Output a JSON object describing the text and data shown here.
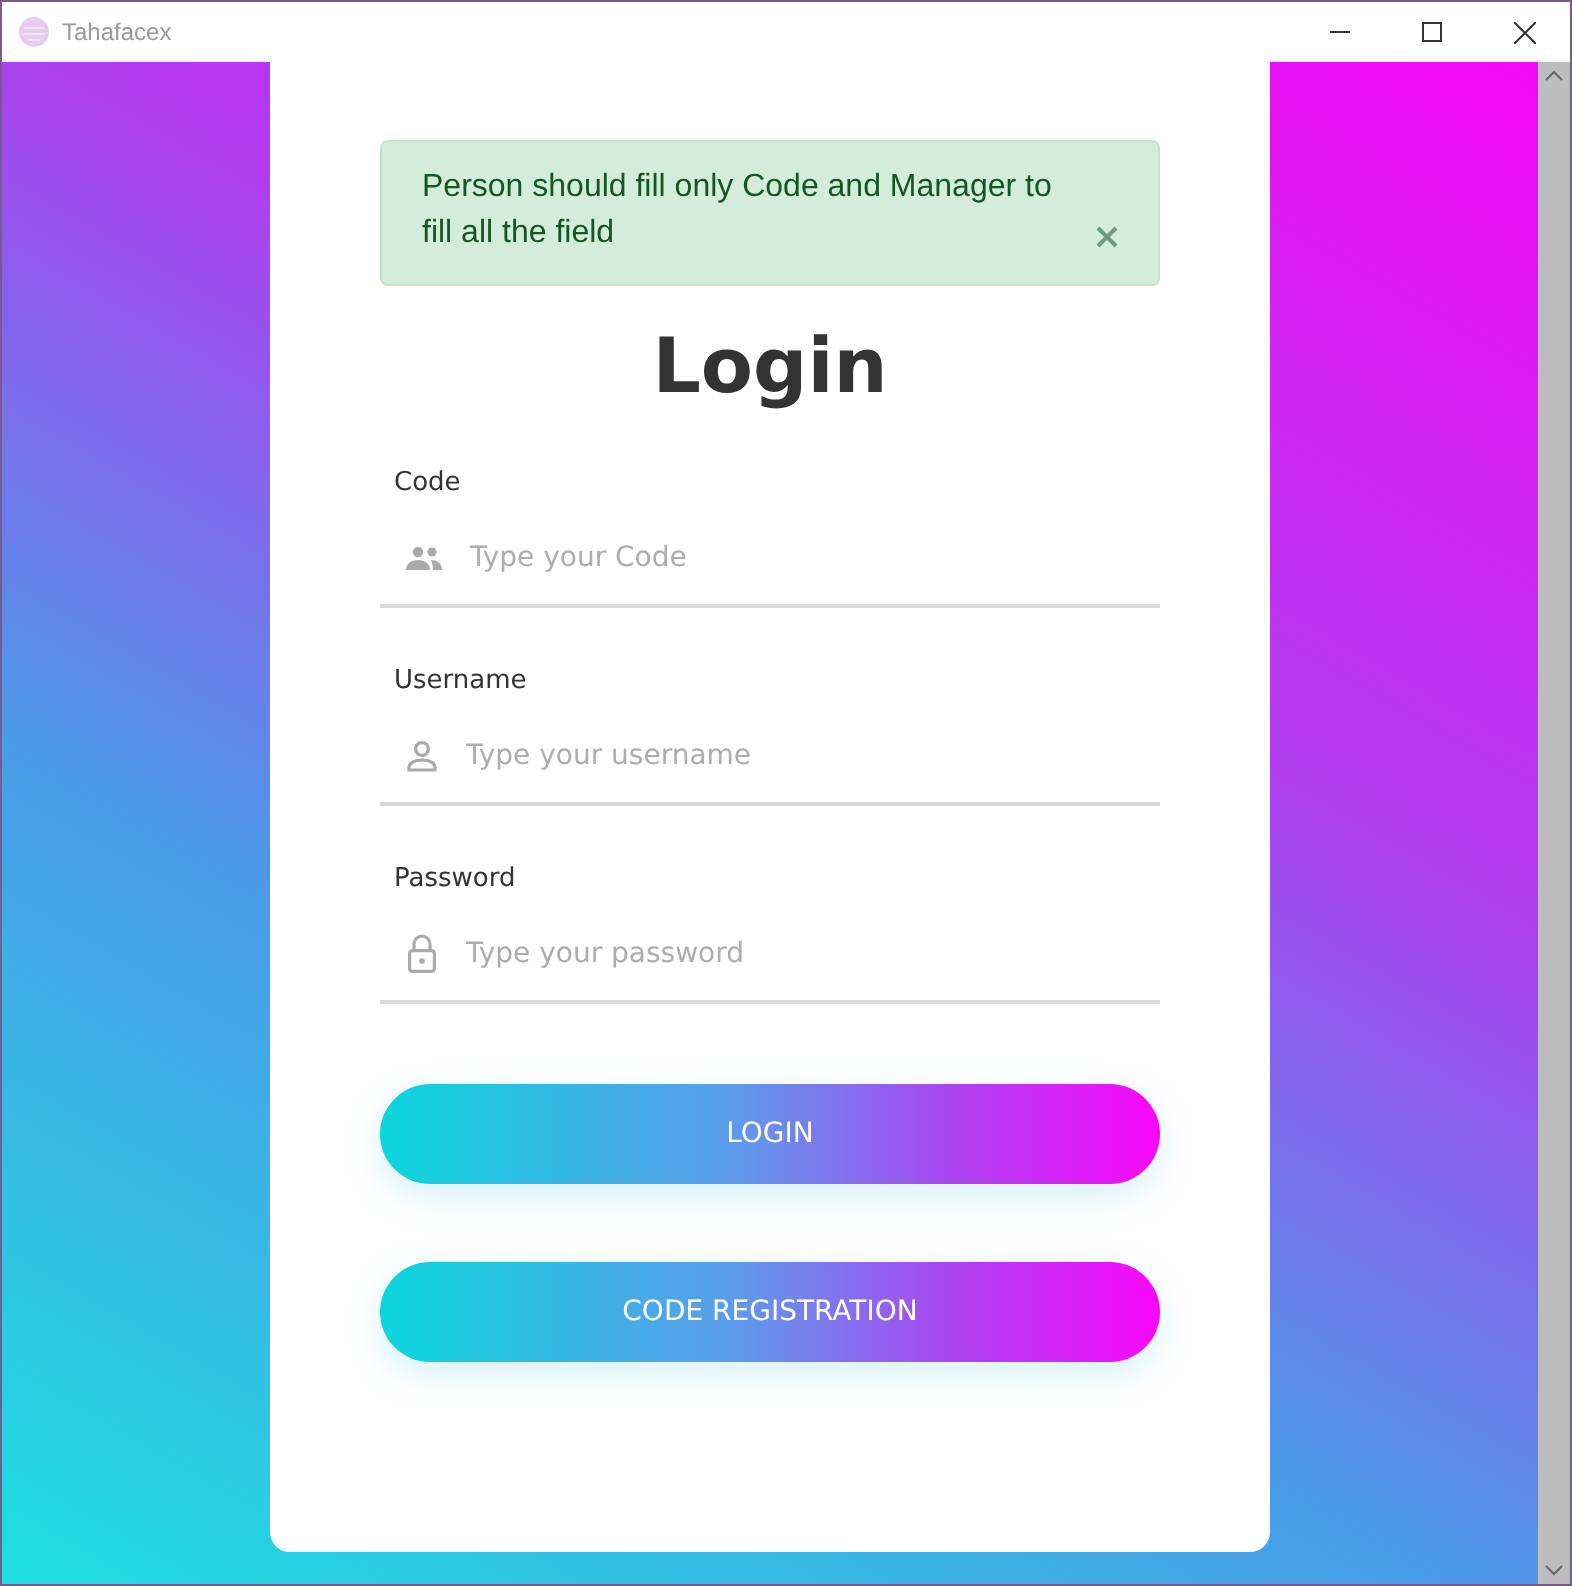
{
  "window": {
    "title": "Tahafacex"
  },
  "alert": {
    "message": "Person should fill only Code and Manager to fill all the field"
  },
  "heading": "Login",
  "fields": [
    {
      "label": "Code",
      "placeholder": "Type your Code",
      "kind": "group"
    },
    {
      "label": "Username",
      "placeholder": "Type your username",
      "kind": "person"
    },
    {
      "label": "Password",
      "placeholder": "Type your password",
      "kind": "lock"
    }
  ],
  "buttons": [
    "LOGIN",
    "CODE REGISTRATION"
  ]
}
